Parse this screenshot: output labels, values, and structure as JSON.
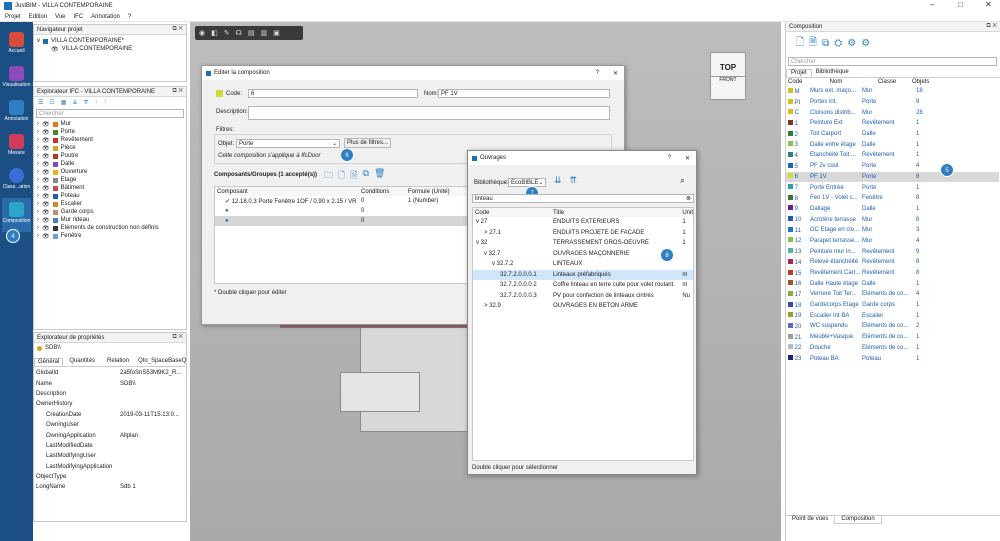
{
  "window": {
    "title": "JustBIM - VILLA CONTEMPORAINE",
    "min": "–",
    "max": "□",
    "close": "✕"
  },
  "menu": [
    "Projet",
    "Edition",
    "Vue",
    "IFC",
    "Annotation",
    "?"
  ],
  "leftbar": [
    {
      "label": "Accueil",
      "color": "#d94b3a"
    },
    {
      "label": "Visualisation",
      "color": "#8b4bb8"
    },
    {
      "label": "Annotation",
      "color": "#2e7fc3"
    },
    {
      "label": "Mesure",
      "color": "#d23b5a"
    },
    {
      "label": "Class...ation",
      "color": "#3a6fd8"
    },
    {
      "label": "Composition",
      "color": "#2aa6c7"
    }
  ],
  "nav": {
    "title": "Navigateur projet",
    "items": [
      "VILLA CONTEMPORAINE*",
      "VILLA CONTEMPORAINE"
    ]
  },
  "ifc": {
    "title": "Explorateur IFC - VILLA CONTEMPORAINE",
    "search_placeholder": "Chercher",
    "items": [
      {
        "label": "Mur",
        "color": "#e0781f"
      },
      {
        "label": "Porte",
        "color": "#4a8a2a"
      },
      {
        "label": "Revêtement",
        "color": "#c93232"
      },
      {
        "label": "Pièce",
        "color": "#d9a21c"
      },
      {
        "label": "Poutre",
        "color": "#b8331e"
      },
      {
        "label": "Dalle",
        "color": "#7a4cc0"
      },
      {
        "label": "Ouverture",
        "color": "#e5b31d"
      },
      {
        "label": "Etage",
        "color": "#888888"
      },
      {
        "label": "Bâtiment",
        "color": "#c24a4a"
      },
      {
        "label": "Poteau",
        "color": "#1f5fb0"
      },
      {
        "label": "Escalier",
        "color": "#c98a2a"
      },
      {
        "label": "Garde corps",
        "color": "#b88e7a"
      },
      {
        "label": "Mur rideau",
        "color": "#4a7ec0"
      },
      {
        "label": "Eléments de construction non définis",
        "color": "#333333"
      },
      {
        "label": "Fenêtre",
        "color": "#6a9ed8"
      }
    ]
  },
  "props": {
    "title": "Explorateur de propriétés",
    "object": "SDB\\\\",
    "tabs": [
      "Général",
      "Quantités",
      "Relation",
      "Qto_SpaceBaseQ"
    ],
    "rows": [
      [
        "GlobalId",
        "2a5foSnS53M9K2_R..."
      ],
      [
        "Name",
        "SDB\\\\"
      ],
      [
        "Description",
        ""
      ],
      [
        "OwnerHistory",
        ""
      ],
      [
        "CreationDate",
        "2019-03-11T15:13:0..."
      ],
      [
        "OwningUser",
        ""
      ],
      [
        "OwningApplication",
        "Allplan"
      ],
      [
        "LastModifiedDate",
        ""
      ],
      [
        "LastModifyingUser",
        ""
      ],
      [
        "LastModifyingApplication",
        ""
      ],
      [
        "ObjectType",
        ""
      ],
      [
        "LongName",
        "Sdb 1"
      ]
    ]
  },
  "editcomp": {
    "title": "Editer la composition",
    "code_label": "Code:",
    "code_value": "6",
    "nom_label": "Nom:",
    "nom_value": "PF 1V",
    "desc_label": "Description:",
    "filtres_label": "Filtres:",
    "objet_label": "Objet:",
    "objet_value": "Porte",
    "more_filters": "Plus de filtres...",
    "applies": "Cette composition s'applique à IfcDoor",
    "groups_title": "Composants/Groupes (1 accepté(s))",
    "cols": [
      "Composant",
      "Conditions",
      "Formule (Unité)"
    ],
    "rows": [
      {
        "name": "12.18.0.3 Porte Fenêtre 1OF / 0.90 x 2.15 / VR",
        "cond": "0",
        "formula": "1 (Number)"
      },
      {
        "name": "",
        "cond": "0",
        "formula": ""
      },
      {
        "name": "",
        "cond": "0",
        "formula": ""
      }
    ],
    "footer": "* Double cliquer pour éditer",
    "help": "?",
    "close": "✕"
  },
  "ouvrages": {
    "title": "Ouvrages",
    "lib_label": "Bibliothèque:",
    "lib_value": "EcoBIBLE",
    "search_value": "linteau",
    "cols": [
      "Code",
      "Title",
      "Unit"
    ],
    "rows": [
      {
        "ind": 0,
        "exp": "v",
        "code": "27",
        "title": "ENDUITS EXTERIEURS",
        "unit": "1"
      },
      {
        "ind": 1,
        "exp": ">",
        "code": "27.1",
        "title": "ENDUITS PROJETE DE FACADE",
        "unit": "1"
      },
      {
        "ind": 0,
        "exp": "v",
        "code": "32",
        "title": "TERRASSEMENT GROS-OEUVRE",
        "unit": "1"
      },
      {
        "ind": 1,
        "exp": "v",
        "code": "32.7",
        "title": "OUVRAGES MAÇONNERIE",
        "unit": ""
      },
      {
        "ind": 2,
        "exp": "v",
        "code": "32.7.2",
        "title": "LINTEAUX",
        "unit": ""
      },
      {
        "ind": 3,
        "exp": "",
        "code": "32.7.2.0.0.0.1",
        "title": "Linteaux préfabriqués",
        "unit": "m",
        "sel": true
      },
      {
        "ind": 3,
        "exp": "",
        "code": "32.7.2.0.0.0.2",
        "title": "Coffre linteau en terre cuite pour volet roulant.",
        "unit": "m"
      },
      {
        "ind": 3,
        "exp": "",
        "code": "32.7.2.0.0.0.3",
        "title": "PV pour confection de linteaux cintrés",
        "unit": "Nu"
      },
      {
        "ind": 1,
        "exp": ">",
        "code": "32.9",
        "title": "OUVRAGES EN BETON ARME",
        "unit": ""
      }
    ],
    "footer": "Double cliquer pour sélectionner",
    "help": "?",
    "close": "✕"
  },
  "viewcube": {
    "top": "TOP",
    "front": "FRONT"
  },
  "composition": {
    "title": "Composition",
    "search_placeholder": "Chercher",
    "tabs": [
      "Projet",
      "Bibliothèque"
    ],
    "cols": [
      "Code",
      "Nom",
      "Classe",
      "Objets"
    ],
    "rows": [
      {
        "code": "M",
        "nom": "Murs ext. maço...",
        "classe": "Mur",
        "obj": "18",
        "color": "#d8c21a"
      },
      {
        "code": "PI",
        "nom": "Portes int.",
        "classe": "Porte",
        "obj": "9",
        "color": "#d8c21a"
      },
      {
        "code": "C",
        "nom": "Cloisons distrib...",
        "classe": "Mur",
        "obj": "28",
        "color": "#d8c21a"
      },
      {
        "code": "1",
        "nom": "Peinture Ext",
        "classe": "Revêtement",
        "obj": "1",
        "color": "#7a3b22"
      },
      {
        "code": "2",
        "nom": "Toit Carport",
        "classe": "Dalle",
        "obj": "1",
        "color": "#2e7d32"
      },
      {
        "code": "3",
        "nom": "Dalle entre étage",
        "classe": "Dalle",
        "obj": "1",
        "color": "#8bc34a"
      },
      {
        "code": "4",
        "nom": "Etanchéité Toit ...",
        "classe": "Revêtement",
        "obj": "1",
        "color": "#2a7f86"
      },
      {
        "code": "5",
        "nom": "PF 2v coul",
        "classe": "Porte",
        "obj": "4",
        "color": "#1565c0"
      },
      {
        "code": "6",
        "nom": "PF 1V",
        "classe": "Porte",
        "obj": "8",
        "color": "#cddc39",
        "sel": true
      },
      {
        "code": "7",
        "nom": "Porte Entrée",
        "classe": "Porte",
        "obj": "1",
        "color": "#26a69a"
      },
      {
        "code": "8",
        "nom": "Fen 1V - Volet c...",
        "classe": "Fenêtre",
        "obj": "8",
        "color": "#2e7d32"
      },
      {
        "code": "9",
        "nom": "Dallage",
        "classe": "Dalle",
        "obj": "1",
        "color": "#6a1b9a"
      },
      {
        "code": "10",
        "nom": "Acrotère terrasse",
        "classe": "Mur",
        "obj": "8",
        "color": "#1e5aa8"
      },
      {
        "code": "11",
        "nom": "GC Etage en clo...",
        "classe": "Mur",
        "obj": "3",
        "color": "#1976d2"
      },
      {
        "code": "12",
        "nom": "Parapet terrasse...",
        "classe": "Mur",
        "obj": "4",
        "color": "#8bc34a"
      },
      {
        "code": "13",
        "nom": "Peinture mur in...",
        "classe": "Revêtement",
        "obj": "9",
        "color": "#4db6ac"
      },
      {
        "code": "14",
        "nom": "Relevé étanchéité",
        "classe": "Revêtement",
        "obj": "8",
        "color": "#b0205a"
      },
      {
        "code": "15",
        "nom": "Revêtement Carr...",
        "classe": "Revêtement",
        "obj": "8",
        "color": "#c0392b"
      },
      {
        "code": "16",
        "nom": "Dalle Haute étage",
        "classe": "Dalle",
        "obj": "1",
        "color": "#a0522d"
      },
      {
        "code": "17",
        "nom": "Verriere Toit Ter...",
        "classe": "Eléments de co...",
        "obj": "4",
        "color": "#7cb342"
      },
      {
        "code": "18",
        "nom": "Gardecorps Etage",
        "classe": "Garde corps",
        "obj": "1",
        "color": "#3949ab"
      },
      {
        "code": "19",
        "nom": "Escalier Int BA",
        "classe": "Escalier",
        "obj": "1",
        "color": "#9e9d24"
      },
      {
        "code": "20",
        "nom": "WC suspendu",
        "classe": "Eléments de co...",
        "obj": "2",
        "color": "#5c6bc0"
      },
      {
        "code": "21",
        "nom": "Meuble+Vasque",
        "classe": "Eléments de co...",
        "obj": "1",
        "color": "#9e9e9e"
      },
      {
        "code": "22",
        "nom": "Douche",
        "classe": "Eléments de co...",
        "obj": "1",
        "color": "#b0bec5"
      },
      {
        "code": "23",
        "nom": "Poteau BA",
        "classe": "Poteau",
        "obj": "1",
        "color": "#1a237e"
      }
    ],
    "bottom_tabs": [
      "Point de vues",
      "Composition"
    ]
  },
  "badges": [
    "4",
    "5",
    "6",
    "7",
    "8"
  ]
}
